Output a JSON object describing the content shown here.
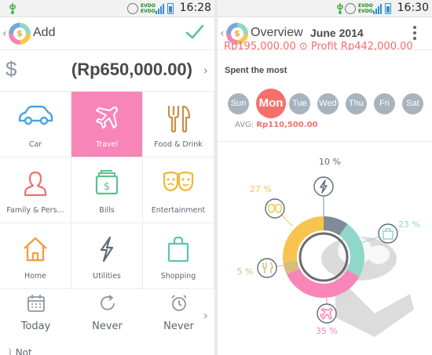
{
  "left_screen": {
    "status": {
      "time": "16:28"
    },
    "appbar": {
      "title": "Add"
    },
    "amount": {
      "currency_symbol": "$",
      "value": "(Rp650,000.00)"
    },
    "categories": [
      {
        "label": "Car",
        "icon": "car-icon",
        "active": false
      },
      {
        "label": "Travel",
        "icon": "airplane-icon",
        "active": true
      },
      {
        "label": "Food & Drink",
        "icon": "fork-knife-icon",
        "active": false
      },
      {
        "label": "Family & Pers...",
        "icon": "person-icon",
        "active": false
      },
      {
        "label": "Bills",
        "icon": "bill-icon",
        "active": false
      },
      {
        "label": "Entertainment",
        "icon": "masks-icon",
        "active": false
      },
      {
        "label": "Home",
        "icon": "house-icon",
        "active": false
      },
      {
        "label": "Utilities",
        "icon": "lightning-icon",
        "active": false
      },
      {
        "label": "Shopping",
        "icon": "shopping-bag-icon",
        "active": false
      }
    ],
    "options": [
      {
        "label": "Today",
        "icon": "calendar-icon"
      },
      {
        "label": "Never",
        "icon": "repeat-icon"
      },
      {
        "label": "Never",
        "icon": "alarm-icon"
      }
    ],
    "note": {
      "label": "Not"
    }
  },
  "right_screen": {
    "status": {
      "time": "16:30"
    },
    "appbar": {
      "title": "Overview",
      "month": "June 2014"
    },
    "peek_text": "Rp195,000.00  ⊙  Profit  Rp442,000.00",
    "spent_most": {
      "label": "Spent the most",
      "days": [
        "Sun",
        "Mon",
        "Tue",
        "Wed",
        "Thu",
        "Fri",
        "Sat"
      ],
      "selected_day": "Mon",
      "avg_label": "AVG:",
      "avg_value": "Rp110,500.00"
    },
    "chart_data": {
      "type": "pie",
      "donut": true,
      "slices": [
        {
          "category": "Utilities",
          "icon": "lightning-icon",
          "percent": 10,
          "label": "10 %",
          "color": "#7f8c98"
        },
        {
          "category": "Shopping",
          "icon": "shopping-bag-icon",
          "percent": 23,
          "label": "23 %",
          "color": "#8fd7c8"
        },
        {
          "category": "Travel",
          "icon": "airplane-icon",
          "percent": 35,
          "label": "35 %",
          "color": "#f885b8"
        },
        {
          "category": "Food & Drink",
          "icon": "fork-knife-icon",
          "percent": 5,
          "label": "5 %",
          "color": "#d7bd7c"
        },
        {
          "category": "Entertainment",
          "icon": "masks-icon",
          "percent": 27,
          "label": "27 %",
          "color": "#f8c44f"
        }
      ]
    }
  },
  "colors": {
    "accent_pink": "#f885b8",
    "accent_red": "#f5706b",
    "accent_green": "#5cc28f",
    "icon_blue": "#4aa3df",
    "icon_red": "#f26d6d",
    "icon_brown": "#c98f45",
    "icon_yellow": "#f0b83a",
    "icon_teal": "#5fc2ae",
    "icon_orange": "#f0a040",
    "icon_slate": "#5e6c7a"
  }
}
